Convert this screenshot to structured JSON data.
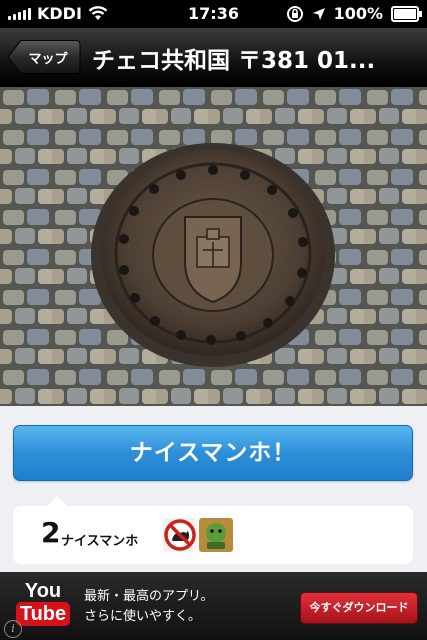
{
  "status": {
    "carrier": "KDDI",
    "time": "17:36",
    "battery": "100%"
  },
  "nav": {
    "back_label": "マップ",
    "title": "チェコ共和国 〒381 01..."
  },
  "actions": {
    "nice_label": "ナイスマンホ！"
  },
  "likes": {
    "count": "2",
    "label": "ナイスマンホ"
  },
  "ad": {
    "logo_top": "You",
    "logo_bottom": "Tube",
    "line1": "最新・最高のアプリ。",
    "line2": "さらに使いやすく。",
    "cta": "今すぐダウンロード"
  }
}
